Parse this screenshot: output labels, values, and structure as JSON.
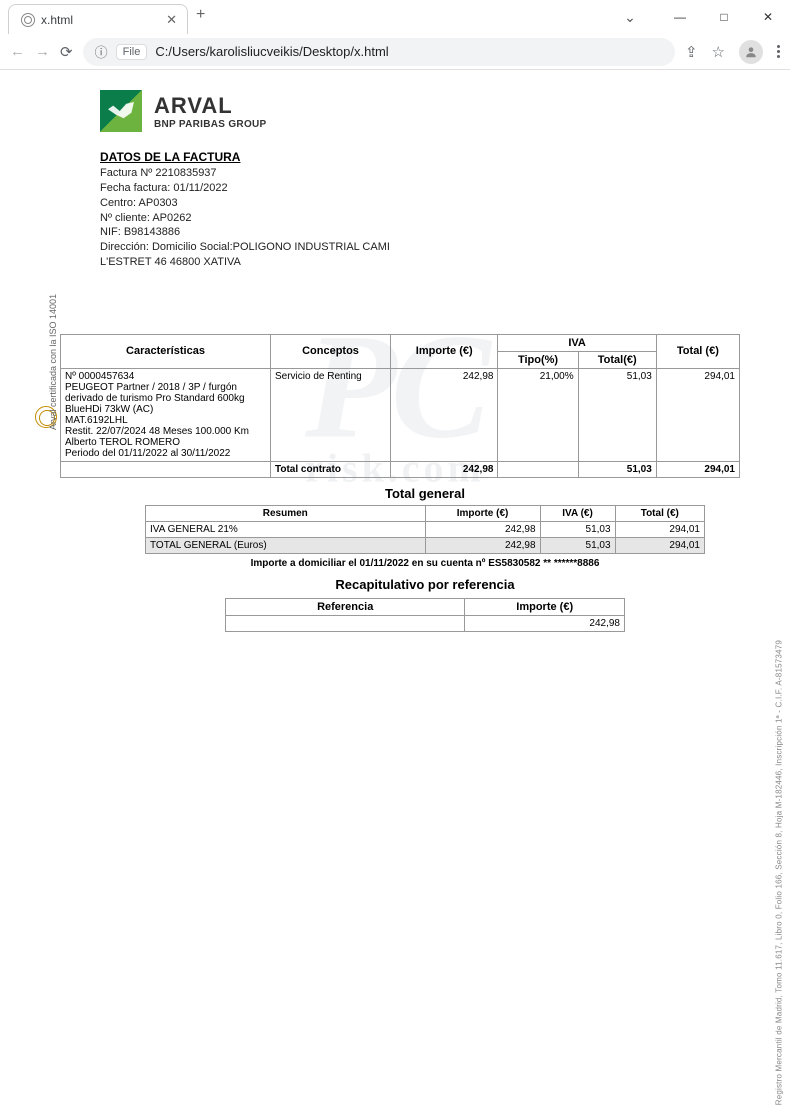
{
  "browser": {
    "tab_title": "x.html",
    "url_prefix": "File",
    "url": "C:/Users/karolisliucveikis/Desktop/x.html"
  },
  "logo": {
    "brand": "ARVAL",
    "sub": "BNP PARIBAS GROUP"
  },
  "datos": {
    "heading": "DATOS DE LA FACTURA",
    "l1": "Factura Nº 2210835937",
    "l2": "Fecha factura:  01/11/2022",
    "l3": "Centro: AP0303",
    "l4": "Nº cliente: AP0262",
    "l5": "NIF: B98143886",
    "l6": "Dirección: Domicilio Social:POLIGONO INDUSTRIAL CAMI",
    "l7": "L'ESTRET 46 46800 XATIVA"
  },
  "table1": {
    "h_car": "Características",
    "h_con": "Conceptos",
    "h_imp": "Importe (€)",
    "h_iva": "IVA",
    "h_iva_tipo": "Tipo(%)",
    "h_iva_tot": "Total(€)",
    "h_tot": "Total (€)",
    "desc": "Nº 0000457634\nPEUGEOT Partner / 2018 / 3P / furgón derivado de turismo Pro Standard 600kg BlueHDi 73kW (AC)\nMAT.6192LHL\nRestit. 22/07/2024 48 Meses 100.000 Km\nAlberto TEROL ROMERO\nPeriodo del 01/11/2022 al 30/11/2022",
    "concepto": "Servicio de Renting",
    "importe": "242,98",
    "iva_tipo": "21,00%",
    "iva_tot": "51,03",
    "total": "294,01",
    "tot_label": "Total contrato",
    "tot_imp": "242,98",
    "tot_iva": "51,03",
    "tot_tot": "294,01"
  },
  "section_general": "Total  general",
  "table2": {
    "h_res": "Resumen",
    "h_imp": "Importe (€)",
    "h_iva": "IVA (€)",
    "h_tot": "Total (€)",
    "r1_lbl": "IVA GENERAL 21%",
    "r1_imp": "242,98",
    "r1_iva": "51,03",
    "r1_tot": "294,01",
    "r2_lbl": "TOTAL GENERAL (Euros)",
    "r2_imp": "242,98",
    "r2_iva": "51,03",
    "r2_tot": "294,01"
  },
  "domiciliar": "Importe a domiciliar el 01/11/2022 en su cuenta nº ES5830582 ** ******8886",
  "section_recap": "Recapitulativo por referencia",
  "table3": {
    "h_ref": "Referencia",
    "h_imp": "Importe (€)",
    "r1_imp": "242,98"
  },
  "side_left": "Arval certificada con la ISO 14001",
  "side_right": "Registro Mercantil de Madrid, Tomo 11.617, Libro 0, Folio 166, Sección 8, Hoja M-182446, Inscripción 1ª - C.I.F. A-81573479"
}
